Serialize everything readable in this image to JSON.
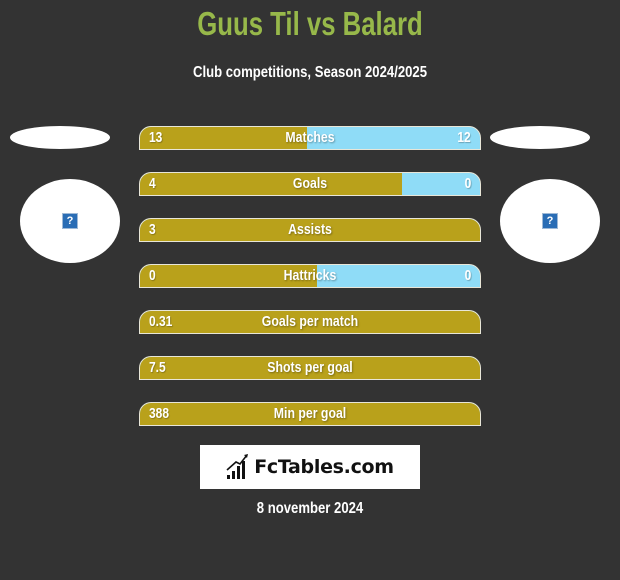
{
  "header": {
    "title": "Guus Til vs Balard",
    "subtitle": "Club competitions, Season 2024/2025"
  },
  "players": {
    "left": {
      "image_icon": "broken-image-icon",
      "glyph": "?"
    },
    "right": {
      "image_icon": "broken-image-icon",
      "glyph": "?"
    }
  },
  "colors": {
    "left_fill": "#b9a11b",
    "right_fill": "#8fdcf7",
    "title": "#97b84a",
    "background": "#333333"
  },
  "stats": [
    {
      "label": "Matches",
      "left": "13",
      "right": "12",
      "left_share": 0.49
    },
    {
      "label": "Goals",
      "left": "4",
      "right": "0",
      "left_share": 0.77
    },
    {
      "label": "Assists",
      "left": "3",
      "right": "",
      "left_share": 1.0
    },
    {
      "label": "Hattricks",
      "left": "0",
      "right": "0",
      "left_share": 0.52
    },
    {
      "label": "Goals per match",
      "left": "0.31",
      "right": "",
      "left_share": 1.0
    },
    {
      "label": "Shots per goal",
      "left": "7.5",
      "right": "",
      "left_share": 1.0
    },
    {
      "label": "Min per goal",
      "left": "388",
      "right": "",
      "left_share": 1.0
    }
  ],
  "footer": {
    "logo_text": "FcTables.com",
    "logo_icon": "bar-chart-icon",
    "date": "8 november 2024"
  }
}
